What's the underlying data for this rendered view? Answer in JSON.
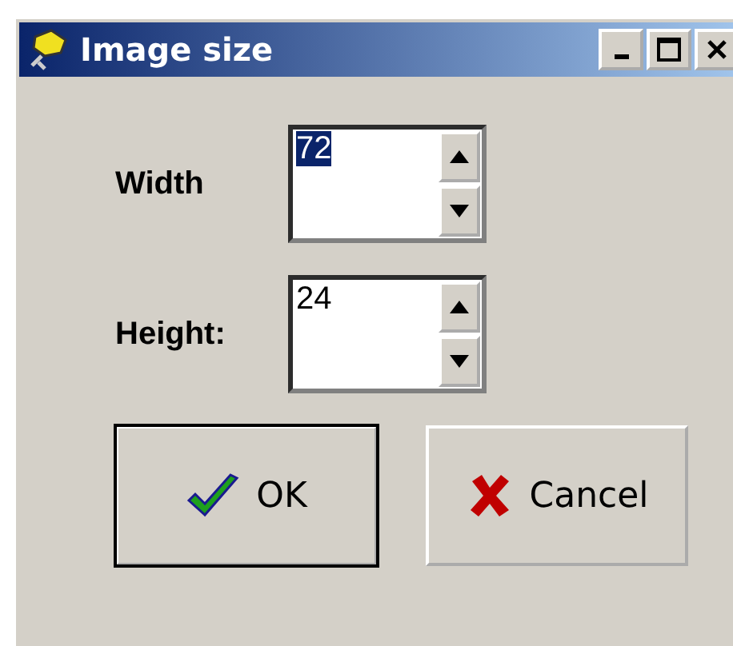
{
  "window": {
    "title": "Image size"
  },
  "fields": [
    {
      "label": "Width",
      "value": "72",
      "selected": true
    },
    {
      "label": "Height:",
      "value": "24",
      "selected": false
    }
  ],
  "buttons": [
    {
      "kind": "ok",
      "label": "OK",
      "default": true
    },
    {
      "kind": "cancel",
      "label": "Cancel",
      "default": false
    }
  ]
}
